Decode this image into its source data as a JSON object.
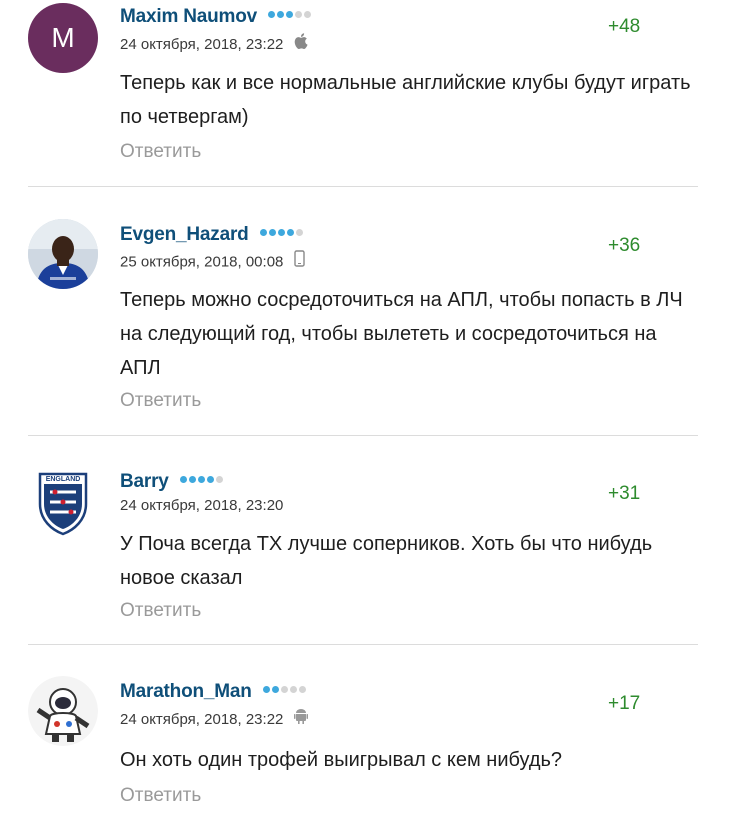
{
  "comments": [
    {
      "avatar_letter": "M",
      "username": "Maxim Naumov",
      "rating_dots": [
        1,
        1,
        1,
        0,
        0
      ],
      "date": "24 октября, 2018, 23:22",
      "device_icon": "apple-icon",
      "score": "+48",
      "text": "Теперь как и все нормальные английские клубы будут играть по четвергам)",
      "reply": "Ответить"
    },
    {
      "username": "Evgen_Hazard",
      "rating_dots": [
        1,
        1,
        1,
        1,
        0
      ],
      "date": "25 октября, 2018, 00:08",
      "device_icon": "mobile-phone-icon",
      "score": "+36",
      "text": "Теперь можно сосредоточиться на АПЛ, чтобы попасть в ЛЧ на следующий год, чтобы вылететь и сосредоточиться на АПЛ",
      "reply": "Ответить"
    },
    {
      "username": "Barry",
      "rating_dots": [
        1,
        1,
        1,
        1,
        0
      ],
      "date": "24 октября, 2018, 23:20",
      "score": "+31",
      "text": "У Поча всегда ТХ лучше соперников. Хоть бы что нибудь новое сказал",
      "reply": "Ответить",
      "badge_text": "ENGLAND"
    },
    {
      "username": "Marathon_Man",
      "rating_dots": [
        1,
        1,
        0,
        0,
        0
      ],
      "date": "24 октября, 2018, 23:22",
      "device_icon": "android-icon",
      "score": "+17",
      "text": "Он хоть один трофей выигрывал с кем нибудь?",
      "reply": "Ответить"
    }
  ],
  "colors": {
    "username": "#0f4f79",
    "score": "#2e8b2e",
    "rating_dot_active": "#3ea8dd",
    "rating_dot_inactive": "#d4d4d4",
    "reply": "#9a9a9a",
    "avatar_m_bg": "#6a2d5e"
  }
}
